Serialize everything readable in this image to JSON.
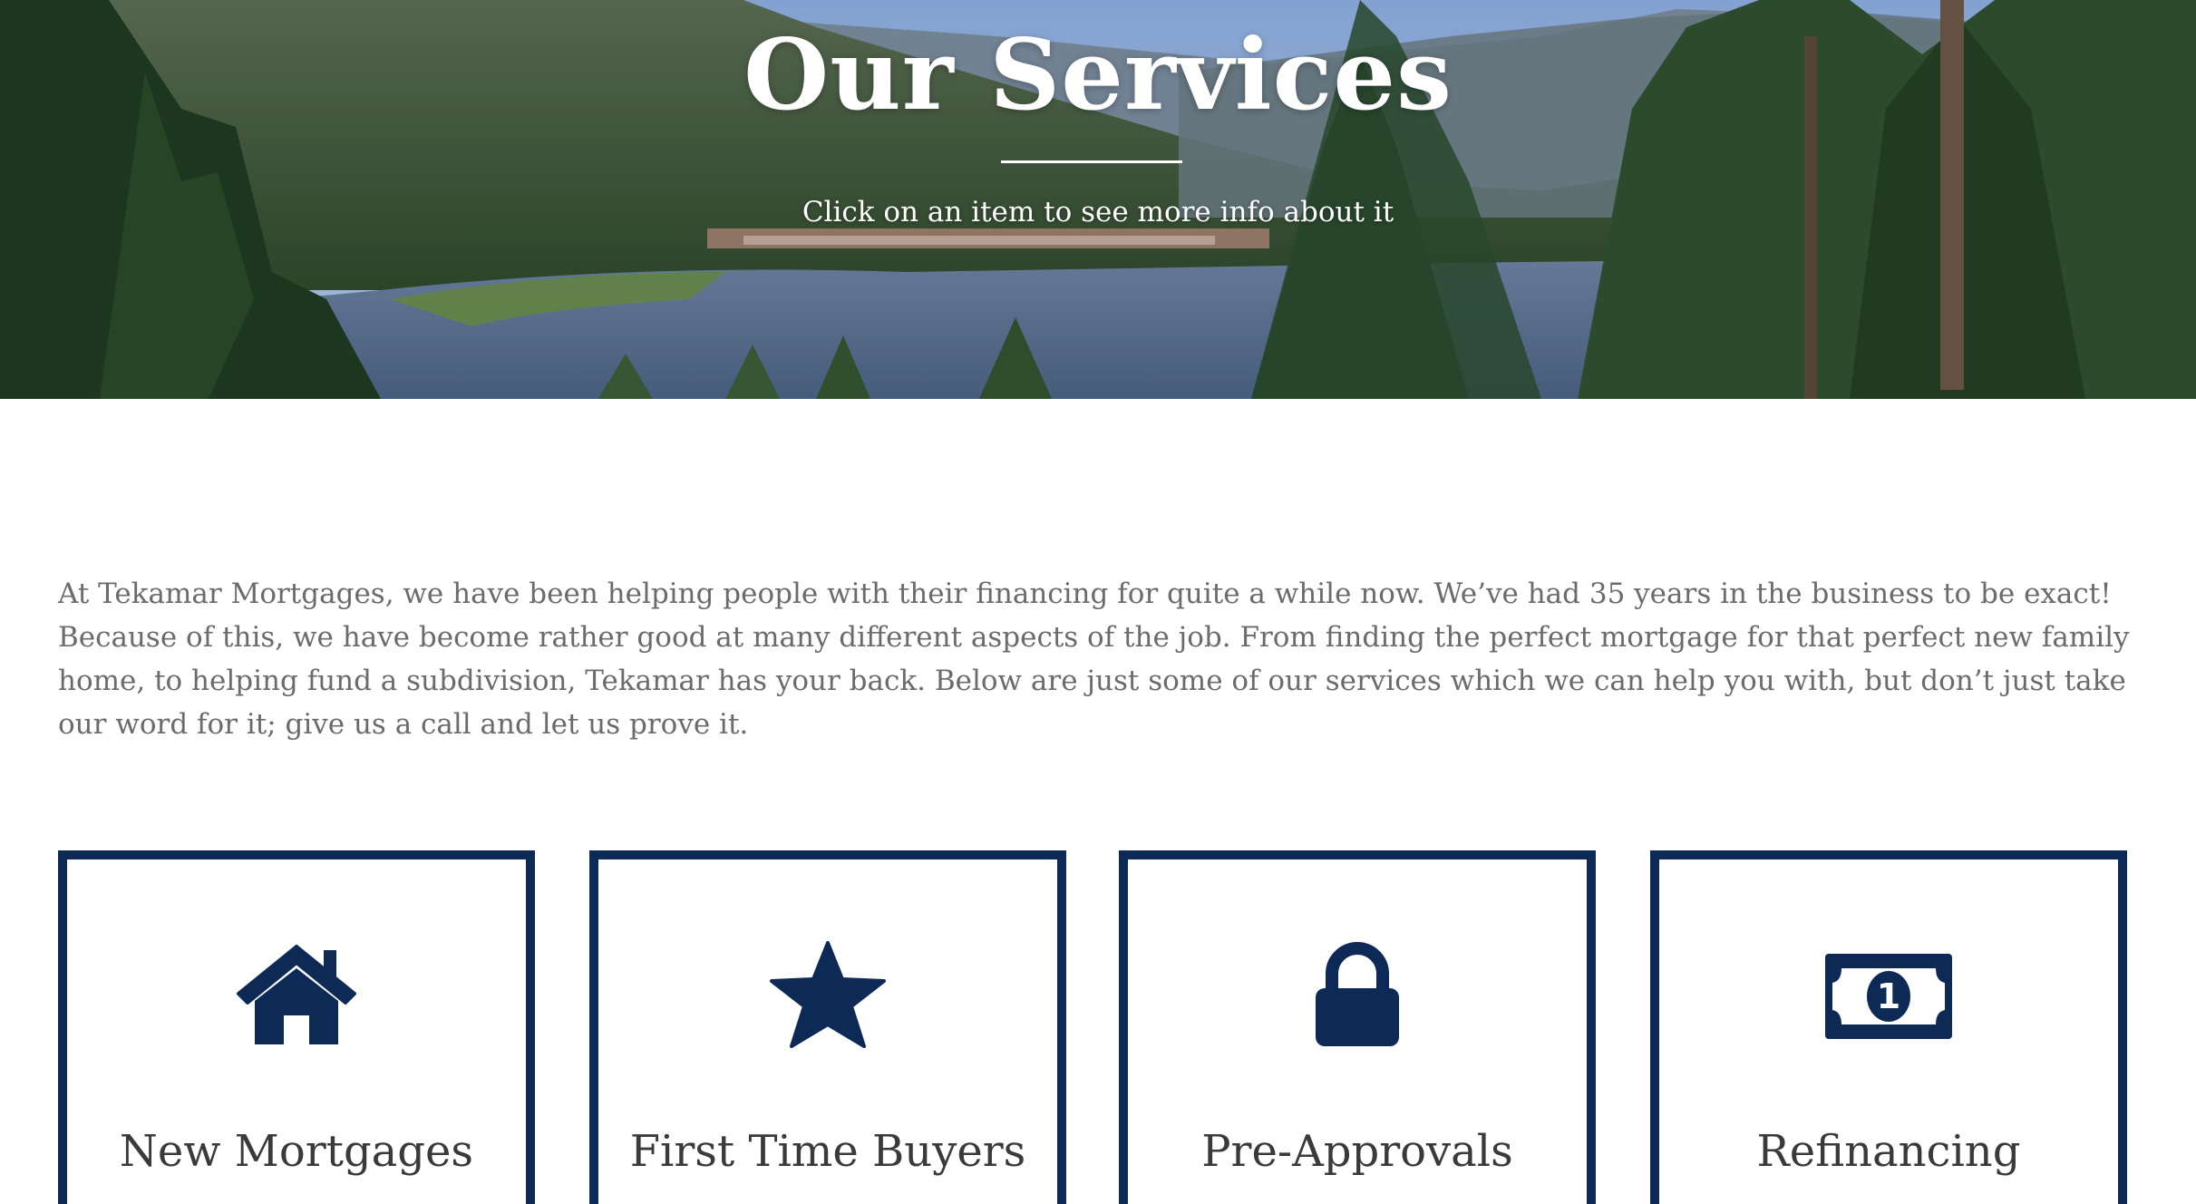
{
  "hero": {
    "title": "Our Services",
    "subtitle": "Click on an item to see more info about it"
  },
  "intro": {
    "text": "At Tekamar Mortgages, we have been helping people with their financing for quite a while now. We’ve had 35 years in the business to be exact! Because of this, we have become rather good at many different aspects of the job. From finding the perfect mortgage for that perfect new family home, to helping fund a subdivision, Tekamar has your back. Below are just some of our services which we can help you with, but don’t just take our word for it; give us a call and let us prove it."
  },
  "colors": {
    "accent": "#0d2a57",
    "text_body": "#6b6b6b",
    "text_card": "#3a3a3a",
    "hero_text": "#ffffff"
  },
  "services": [
    {
      "label": "New Mortgages",
      "icon": "house-icon"
    },
    {
      "label": "First Time Buyers",
      "icon": "star-icon"
    },
    {
      "label": "Pre-Approvals",
      "icon": "lock-icon"
    },
    {
      "label": "Refinancing",
      "icon": "dollar-bill-icon"
    }
  ]
}
